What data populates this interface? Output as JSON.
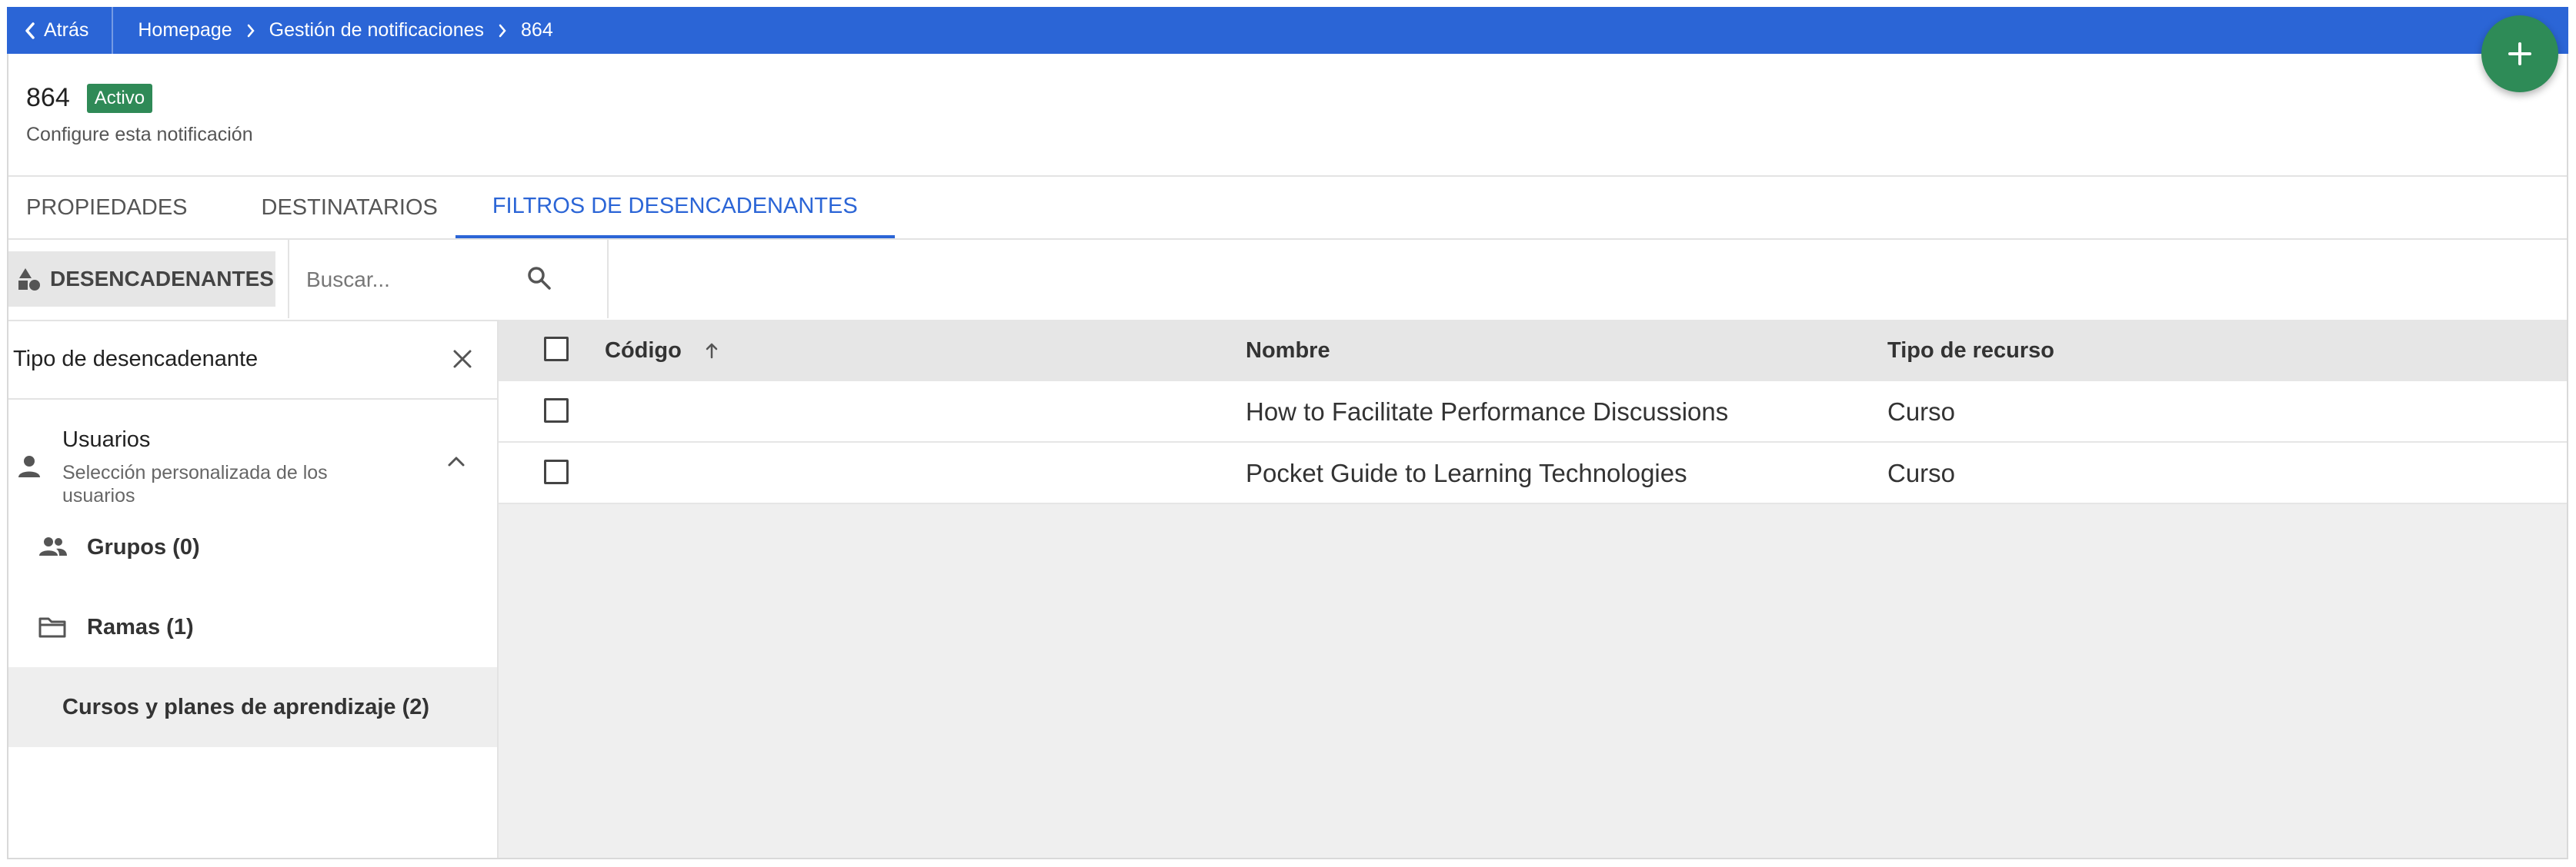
{
  "topbar": {
    "back_label": "Atrás",
    "breadcrumbs": [
      "Homepage",
      "Gestión de notificaciones",
      "864"
    ]
  },
  "header": {
    "title": "864",
    "status": "Activo",
    "subtitle": "Configure esta notificación"
  },
  "tabs": [
    "PROPIEDADES",
    "DESTINATARIOS",
    "FILTROS DE DESENCADENANTES"
  ],
  "toolbar": {
    "filter_label": "DESENCADENANTES",
    "search_placeholder": "Buscar..."
  },
  "left_panel": {
    "title": "Tipo de desencadenante",
    "users_title": "Usuarios",
    "users_subtitle": "Selección personalizada de los usuarios",
    "items": [
      {
        "label": "Grupos (0)",
        "icon": "group-icon"
      },
      {
        "label": "Ramas (1)",
        "icon": "folder-icon"
      },
      {
        "label": "Cursos y planes de aprendizaje (2)",
        "icon": ""
      }
    ]
  },
  "table": {
    "columns": [
      "Código",
      "Nombre",
      "Tipo de recurso"
    ],
    "rows": [
      {
        "code": "",
        "name": "How to Facilitate Performance Discussions",
        "type": "Curso"
      },
      {
        "code": "",
        "name": "Pocket Guide to Learning Technologies",
        "type": "Curso"
      }
    ]
  },
  "colors": {
    "topbar": "#2b65d6",
    "accent": "#2b65d6",
    "badge": "#2f8a57",
    "fab": "#2e8b57"
  }
}
